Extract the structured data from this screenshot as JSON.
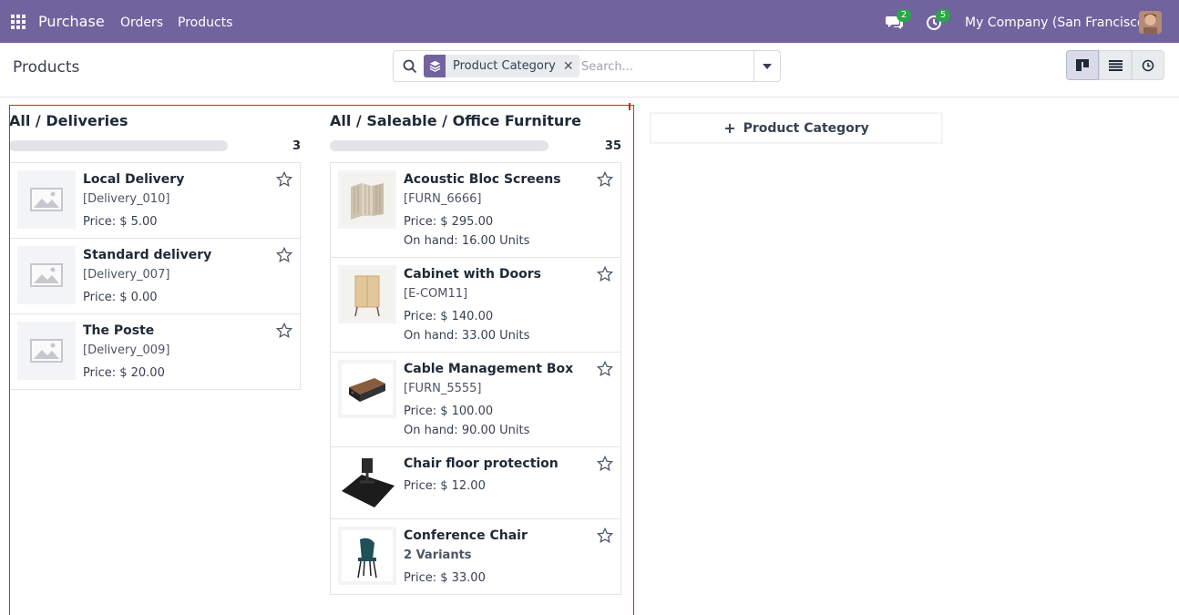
{
  "navbar": {
    "app_name": "Purchase",
    "menu": [
      "Orders",
      "Products"
    ],
    "messages_count": "2",
    "activities_count": "5",
    "company": "My Company (San Francisco)"
  },
  "control": {
    "title": "Products",
    "facet_label": "Product Category",
    "search_placeholder": "Search..."
  },
  "columns": [
    {
      "title": "All / Deliveries",
      "count": "3",
      "cards": [
        {
          "name": "Local Delivery",
          "ref": "[Delivery_010]",
          "price": "Price: $ 5.00",
          "image": "placeholder-image"
        },
        {
          "name": "Standard delivery",
          "ref": "[Delivery_007]",
          "price": "Price: $ 0.00",
          "image": "placeholder-image"
        },
        {
          "name": "The Poste",
          "ref": "[Delivery_009]",
          "price": "Price: $ 20.00",
          "image": "placeholder-image"
        }
      ]
    },
    {
      "title": "All / Saleable / Office Furniture",
      "count": "35",
      "cards": [
        {
          "name": "Acoustic Bloc Screens",
          "ref": "[FURN_6666]",
          "price": "Price: $ 295.00",
          "onhand": "On hand: 16.00 Units",
          "image": "screens-image"
        },
        {
          "name": "Cabinet with Doors",
          "ref": "[E-COM11]",
          "price": "Price: $ 140.00",
          "onhand": "On hand: 33.00 Units",
          "image": "cabinet-image"
        },
        {
          "name": "Cable Management Box",
          "ref": "[FURN_5555]",
          "price": "Price: $ 100.00",
          "onhand": "On hand: 90.00 Units",
          "image": "cable-box-image"
        },
        {
          "name": "Chair floor protection",
          "price": "Price: $ 12.00",
          "image": "floor-mat-image"
        },
        {
          "name": "Conference Chair",
          "variants": "2 Variants",
          "price": "Price: $ 33.00",
          "image": "chair-image"
        }
      ]
    }
  ],
  "add_group_label": "Product Category",
  "colors": {
    "brand": "#71639e",
    "badge": "#28a745",
    "annotation": "#e32020"
  }
}
